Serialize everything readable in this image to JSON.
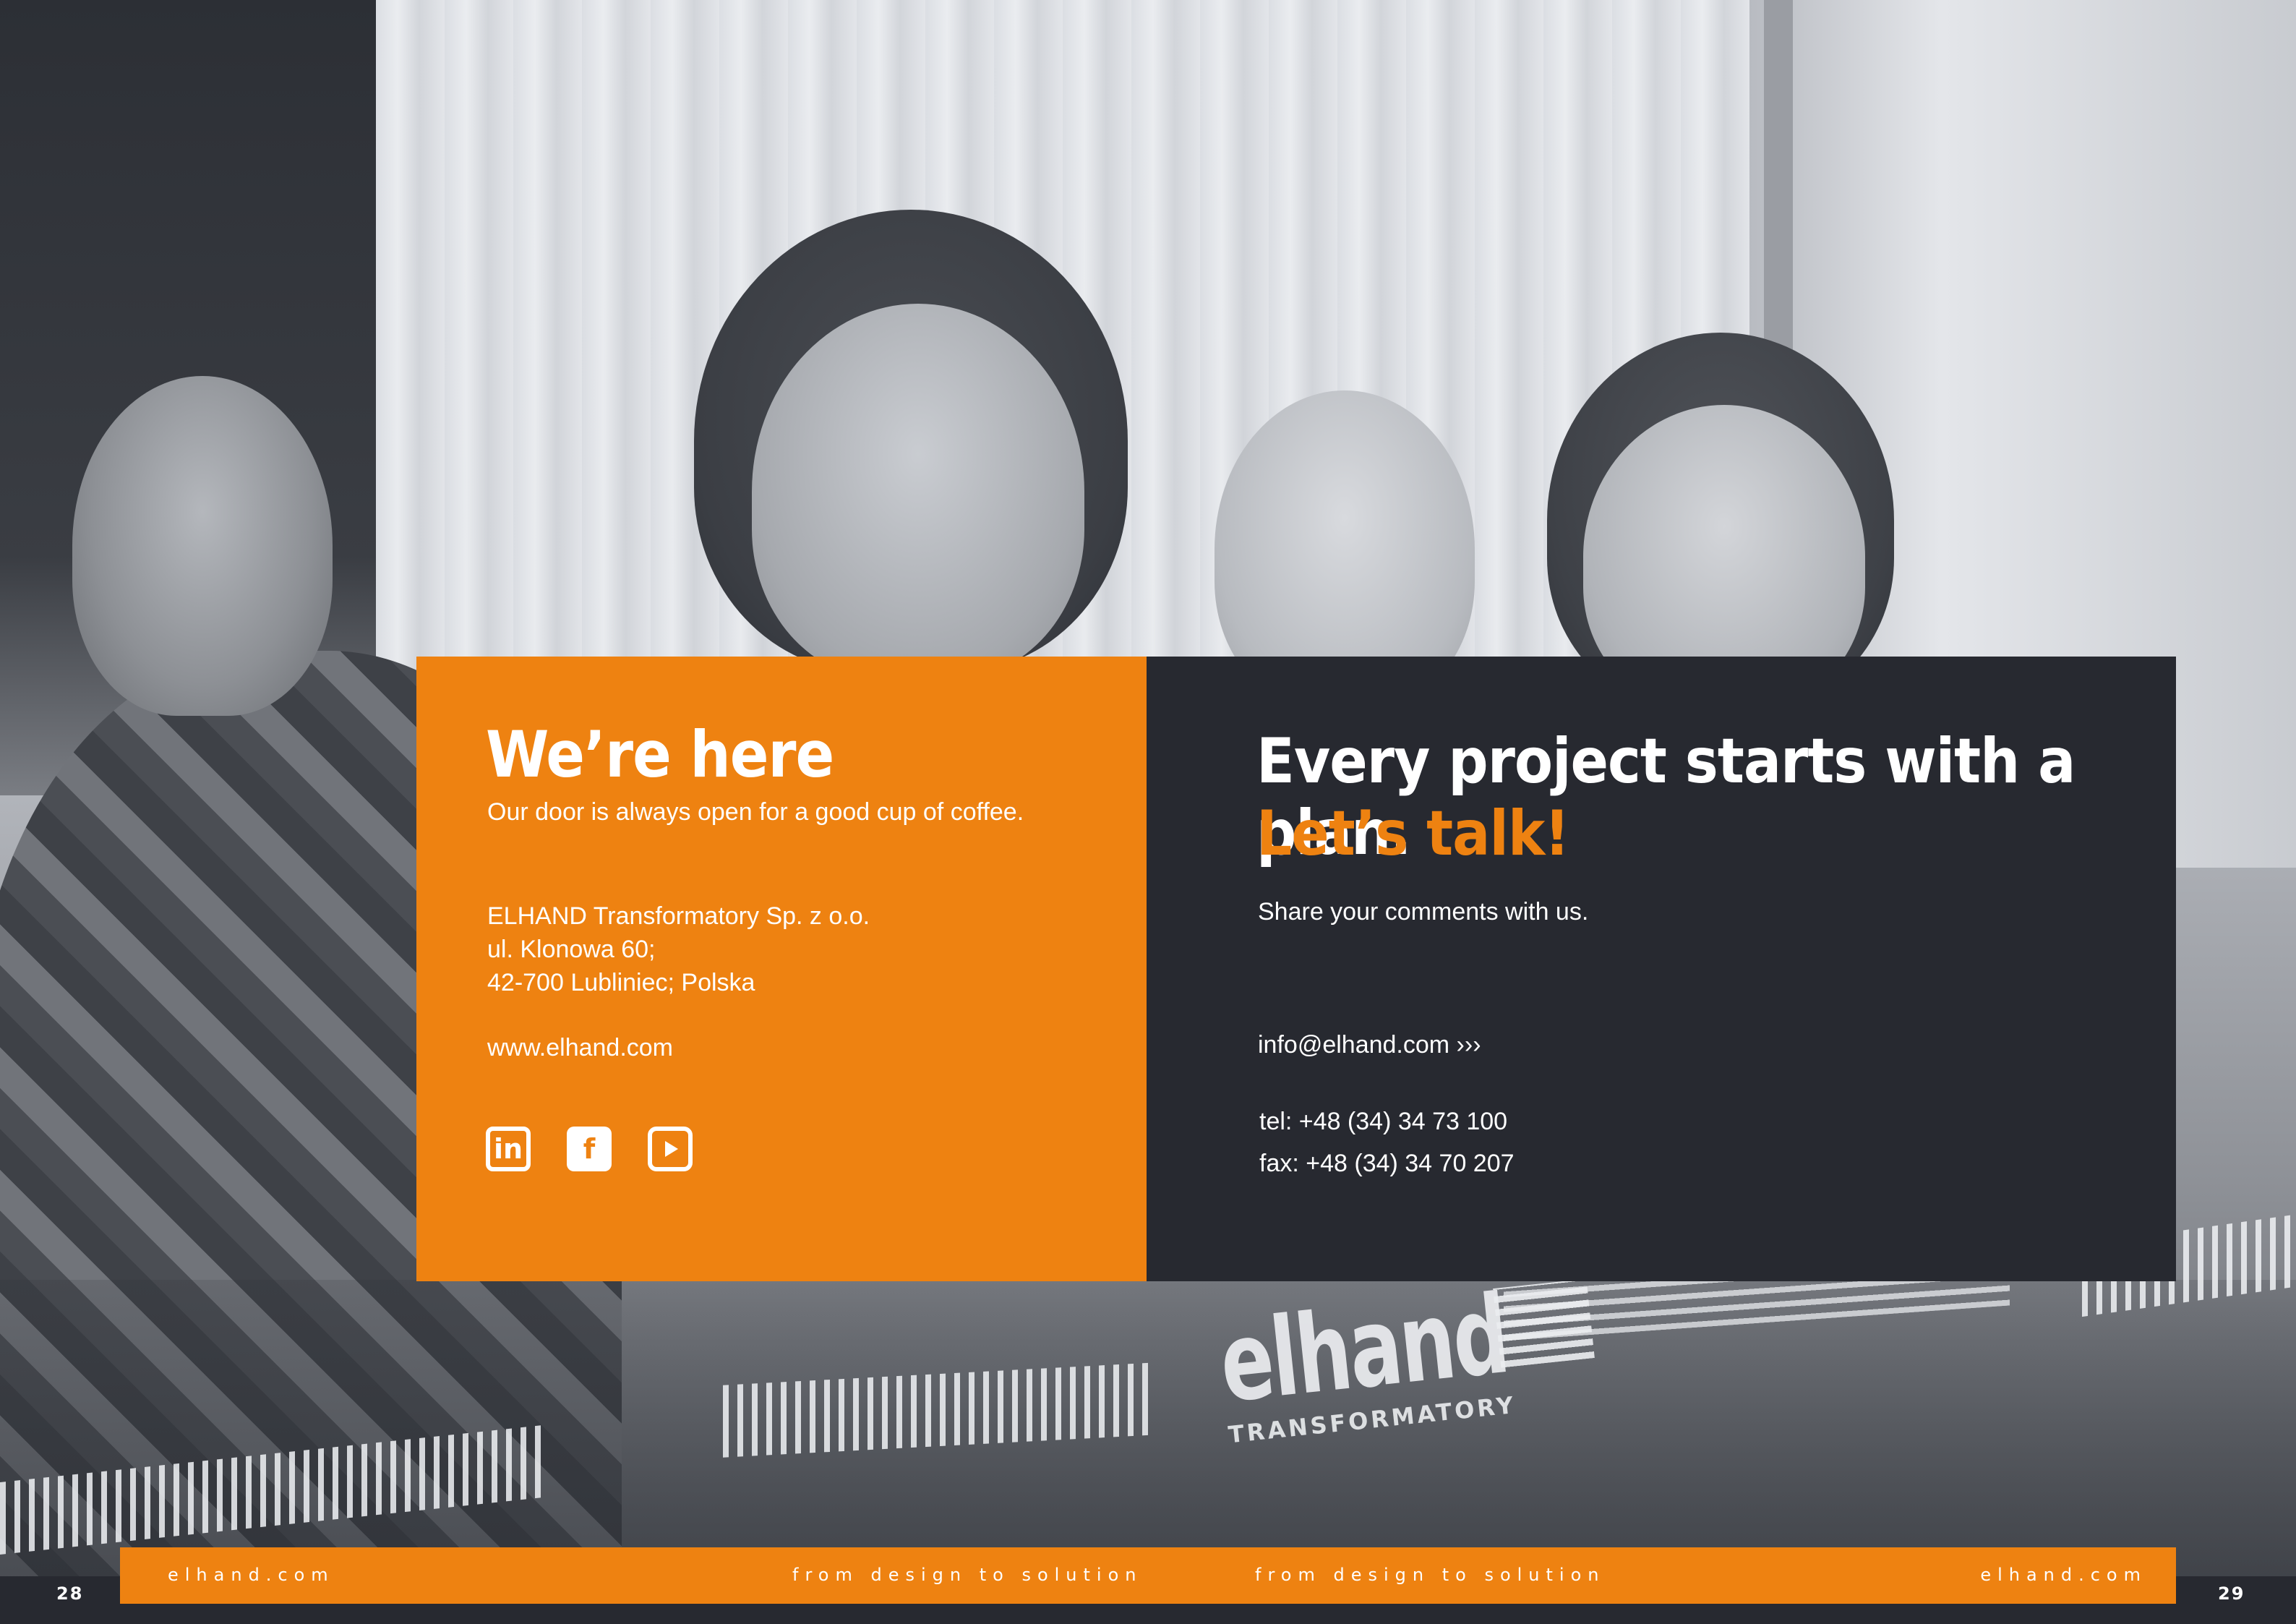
{
  "left_panel": {
    "title": "We’re here",
    "subtitle": "Our door is always open for a good cup of coffee.",
    "address_lines": [
      "ELHAND Transformatory Sp. z o.o.",
      "ul. Klonowa 60;",
      "42-700 Lubliniec; Polska"
    ],
    "website": "www.elhand.com",
    "social": [
      {
        "icon": "linkedin-icon",
        "glyph": "in"
      },
      {
        "icon": "facebook-icon",
        "glyph": "f"
      },
      {
        "icon": "youtube-icon",
        "glyph": ""
      }
    ]
  },
  "right_panel": {
    "title": "Every project starts with a plan.",
    "highlight": "Let’s talk!",
    "share_text": "Share your comments with us.",
    "email": "info@elhand.com  ›››",
    "tel": "tel: +48 (34) 34 73 100",
    "fax": "fax: +48 (34) 34 70 207"
  },
  "photo_logo": {
    "word": "elhand",
    "sub": "TRANSFORMATORY"
  },
  "footer": {
    "left_site": "elhand.com",
    "left_tagline": "from design to solution",
    "right_tagline": "from design to solution",
    "right_site": "elhand.com",
    "page_left": "28",
    "page_right": "29"
  },
  "colors": {
    "accent": "#ee8211",
    "dark_panel": "#272930",
    "text_light": "#ffffff"
  }
}
